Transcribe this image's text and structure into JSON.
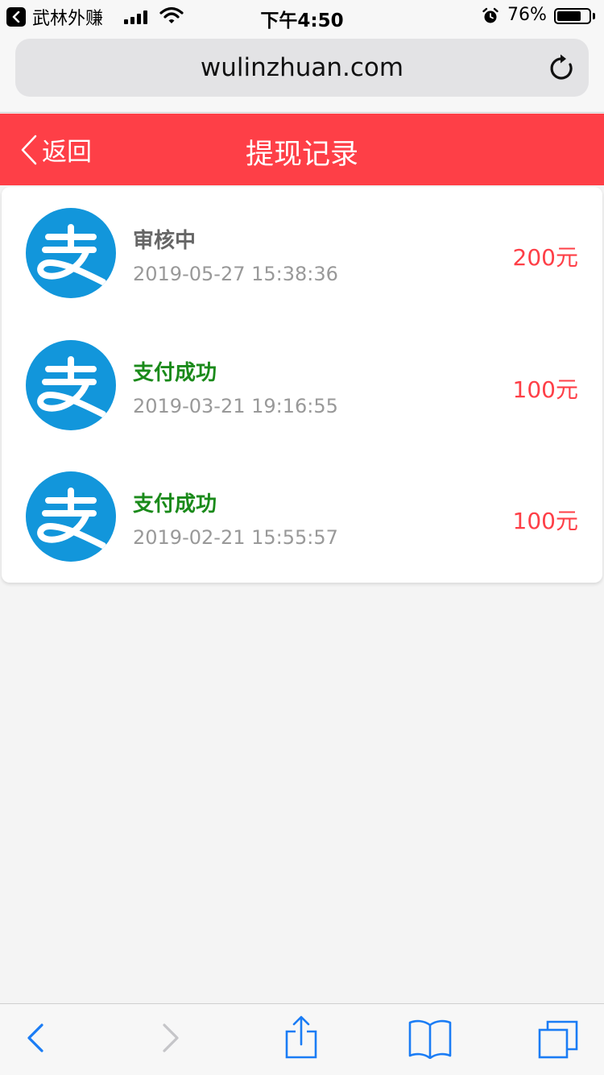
{
  "status_bar": {
    "back_app_label": "武林外赚",
    "time": "下午4:50",
    "battery_percent_text": "76%",
    "battery_level": 0.76
  },
  "browser": {
    "url": "wulinzhuan.com"
  },
  "header": {
    "back_label": "返回",
    "title": "提现记录",
    "color": "#fe3f47"
  },
  "records": [
    {
      "status": "审核中",
      "status_color": "#666666",
      "time": "2019-05-27 15:38:36",
      "amount": "200元",
      "icon": "alipay-icon"
    },
    {
      "status": "支付成功",
      "status_color": "#1a8a1a",
      "time": "2019-03-21 19:16:55",
      "amount": "100元",
      "icon": "alipay-icon"
    },
    {
      "status": "支付成功",
      "status_color": "#1a8a1a",
      "time": "2019-02-21 15:55:57",
      "amount": "100元",
      "icon": "alipay-icon"
    }
  ],
  "toolbar": {
    "icons": [
      "back-arrow-icon",
      "forward-arrow-icon",
      "share-icon",
      "bookmarks-icon",
      "tabs-icon"
    ]
  }
}
